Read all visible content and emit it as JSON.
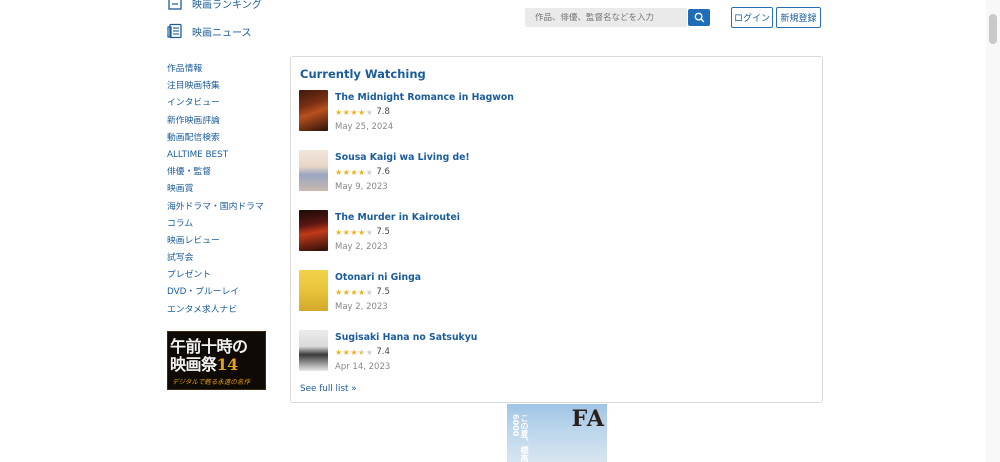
{
  "top_nav": [
    {
      "label": "映画ランキング",
      "icon": "ranking-icon"
    },
    {
      "label": "映画ニュース",
      "icon": "news-icon"
    }
  ],
  "search": {
    "placeholder": "作品、俳優、監督名などを入力"
  },
  "auth": {
    "login": "ログイン",
    "register": "新規登録"
  },
  "side_menu": [
    "作品情報",
    "注目映画特集",
    "インタビュー",
    "新作映画評論",
    "動画配信検索",
    "ALLTIME BEST",
    "俳優・監督",
    "映画賞",
    "海外ドラマ・国内ドラマ",
    "コラム",
    "映画レビュー",
    "試写会",
    "プレゼント",
    "DVD・ブルーレイ",
    "エンタメ求人ナビ"
  ],
  "banner": {
    "line1": "午前十時の",
    "line2a": "映画祭",
    "line2b": "14",
    "line3": "デジタルで甦る永遠の名作"
  },
  "panel": {
    "title": "Currently Watching",
    "entries": [
      {
        "title": "The Midnight Romance in Hagwon",
        "rating": 7.8,
        "rating_text": "7.8",
        "date": "May 25, 2024"
      },
      {
        "title": "Sousa Kaigi wa Living de!",
        "rating": 7.6,
        "rating_text": "7.6",
        "date": "May 9, 2023"
      },
      {
        "title": "The Murder in Kairoutei",
        "rating": 7.5,
        "rating_text": "7.5",
        "date": "May 2, 2023"
      },
      {
        "title": "Otonari ni Ginga",
        "rating": 7.5,
        "rating_text": "7.5",
        "date": "May 2, 2023"
      },
      {
        "title": "Sugisaki Hana no Satsukyu",
        "rating": 7.4,
        "rating_text": "7.4",
        "date": "Apr 14, 2023"
      }
    ],
    "see_full": "See full list »"
  },
  "bottom_poster": {
    "vertical_text": "この夏、標高6000",
    "big_text": "FA"
  },
  "colors": {
    "link": "#1b5c9a",
    "search_button": "#1f6db7",
    "star": "#f0b020"
  }
}
